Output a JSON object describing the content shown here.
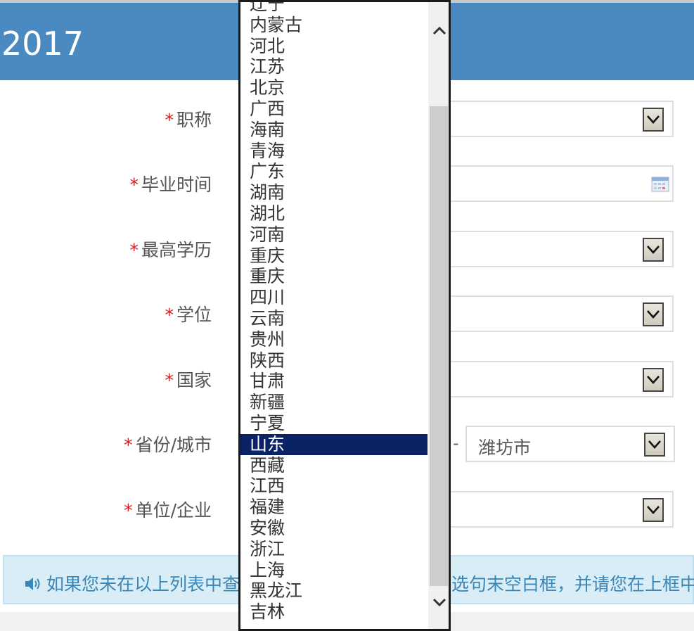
{
  "header": {
    "title": "2017"
  },
  "form": {
    "fields": [
      {
        "label": "职称",
        "type": "select"
      },
      {
        "label": "毕业时间",
        "type": "date"
      },
      {
        "label": "最高学历",
        "type": "select"
      },
      {
        "label": "学位",
        "type": "select"
      },
      {
        "label": "国家",
        "type": "select"
      },
      {
        "label": "省份/城市",
        "type": "province-city",
        "city_value": "潍坊市",
        "separator": "-"
      },
      {
        "label": "单位/企业",
        "type": "select"
      }
    ],
    "required_mark": "*"
  },
  "notice": {
    "text_left": "如果您未在以上列表中查",
    "text_right": "选句末空白框，并请您在上框中",
    "icon": "volume-icon"
  },
  "province_dropdown": {
    "items": [
      "辽宁",
      "内蒙古",
      "河北",
      "江苏",
      "北京",
      "广西",
      "海南",
      "青海",
      "广东",
      "湖南",
      "湖北",
      "河南",
      "重庆",
      "重庆",
      "四川",
      "云南",
      "贵州",
      "陕西",
      "甘肃",
      "新疆",
      "宁夏",
      "山东",
      "西藏",
      "江西",
      "福建",
      "安徽",
      "浙江",
      "上海",
      "黑龙江",
      "吉林"
    ],
    "selected_index": 21
  },
  "colors": {
    "header_bg": "#4a8ac1",
    "selected_bg": "#0b2265",
    "required": "#d21f1f",
    "notice_bg": "#d8edf6",
    "notice_text": "#3a86b6"
  }
}
